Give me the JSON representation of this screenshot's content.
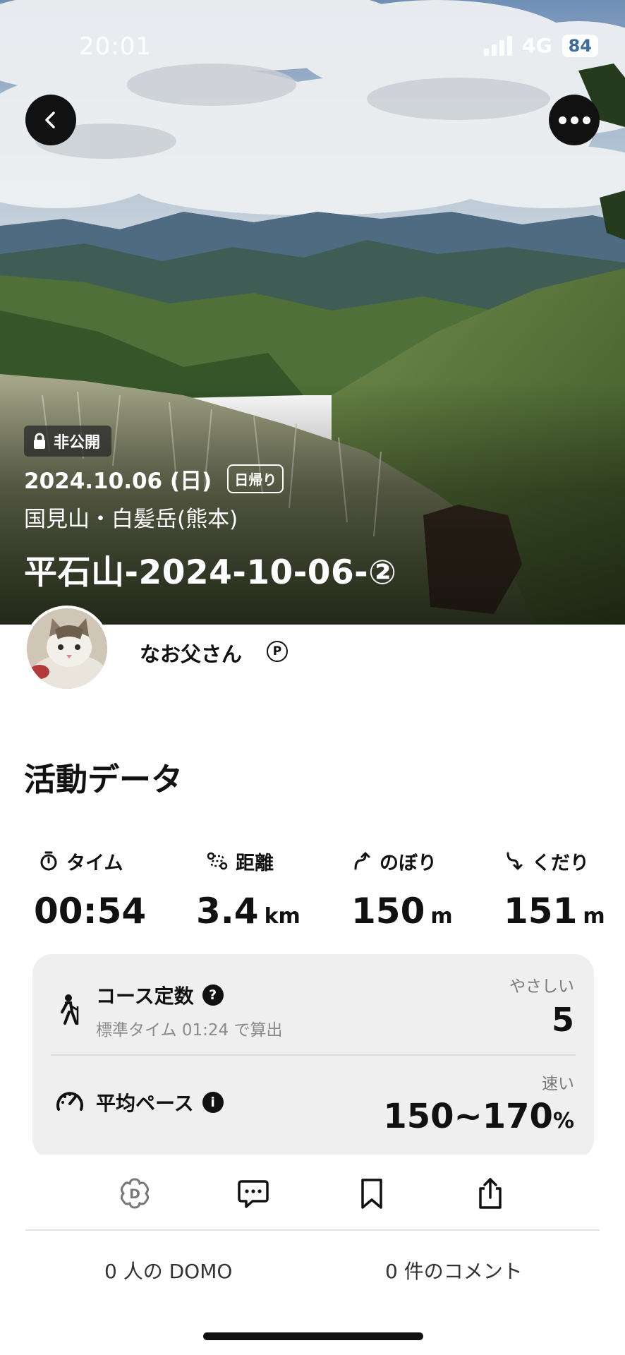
{
  "status_bar": {
    "time": "20:01",
    "network": "4G",
    "battery": "84"
  },
  "header": {
    "private_label": "非公開",
    "date": "2024.10.06 (日)",
    "trip_type": "日帰り",
    "area": "国見山・白髪岳(熊本)",
    "title": "平石山-2024-10-06-②"
  },
  "user": {
    "name": "なお父さん",
    "premium_badge": "P"
  },
  "activity": {
    "title": "活動データ",
    "stats": [
      {
        "label": "タイム",
        "icon": "stopwatch-icon",
        "value": "00:54",
        "unit": ""
      },
      {
        "label": "距離",
        "icon": "route-icon",
        "value": "3.4",
        "unit": "km"
      },
      {
        "label": "のぼり",
        "icon": "ascent-icon",
        "value": "150",
        "unit": "m"
      },
      {
        "label": "くだり",
        "icon": "descent-icon",
        "value": "151",
        "unit": "m"
      }
    ],
    "course_constant": {
      "label": "コース定数",
      "help_icon": "?",
      "sub": "標準タイム 01:24 で算出",
      "rating": "やさしい",
      "value": "5"
    },
    "avg_pace": {
      "label": "平均ペース",
      "info_icon": "i",
      "rating": "速い",
      "value": "150~170",
      "unit": "%"
    }
  },
  "actions": {
    "icons": [
      "domo-icon",
      "comment-icon",
      "bookmark-icon",
      "share-icon"
    ],
    "domo_count": "0 人の DOMO",
    "comment_count": "0 件のコメント"
  },
  "colors": {
    "accent": "#3b6e9c",
    "card_bg": "#efefef"
  }
}
